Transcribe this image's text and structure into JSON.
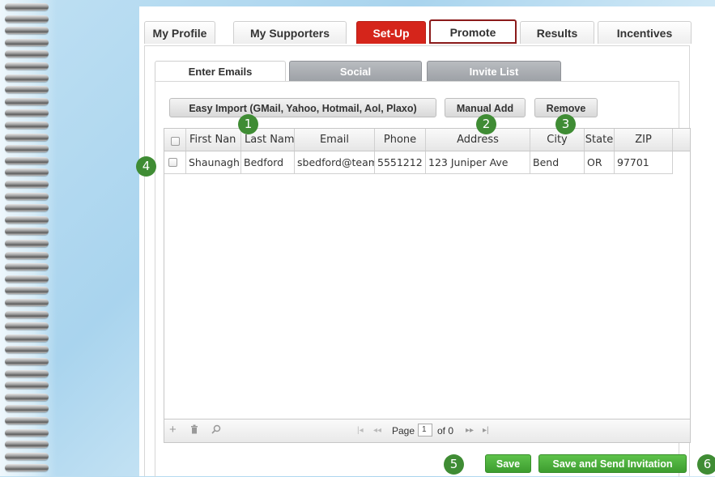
{
  "tabs": [
    {
      "label": "My Profile"
    },
    {
      "label": "My Supporters"
    },
    {
      "label": "Set-Up"
    },
    {
      "label": "Promote"
    },
    {
      "label": "Results"
    },
    {
      "label": "Incentives"
    }
  ],
  "subtabs": [
    {
      "label": "Enter Emails"
    },
    {
      "label": "Social"
    },
    {
      "label": "Invite List"
    }
  ],
  "toolbar": {
    "easy_import": "Easy Import (GMail, Yahoo, Hotmail, Aol, Plaxo)",
    "manual_add": "Manual Add",
    "remove": "Remove"
  },
  "grid": {
    "columns": [
      "First Nan",
      "Last Nam",
      "Email",
      "Phone",
      "Address",
      "City",
      "State",
      "ZIP"
    ],
    "rows": [
      {
        "first": "Shaunagh",
        "last": "Bedford",
        "email": "sbedford@team",
        "phone": "5551212",
        "address": "123 Juniper Ave",
        "city": "Bend",
        "state": "OR",
        "zip": "97701"
      }
    ]
  },
  "pager": {
    "page_label": "Page",
    "page_value": "1",
    "of_label": "of 0"
  },
  "actions": {
    "save": "Save",
    "save_send": "Save and Send Invitation"
  },
  "badges": [
    "1",
    "2",
    "3",
    "4",
    "5",
    "6"
  ],
  "colors": {
    "accent_red": "#d5251b",
    "green": "#3d9d2f",
    "badge_green": "#3f8c34"
  }
}
